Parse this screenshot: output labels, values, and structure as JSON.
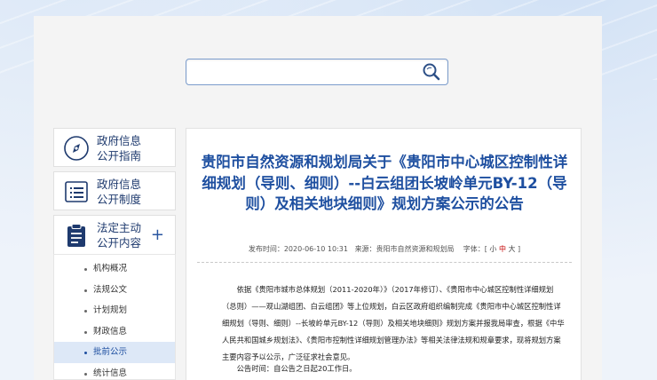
{
  "search": {
    "value": "",
    "placeholder": ""
  },
  "sidebar": {
    "items": [
      {
        "line1": "政府信息",
        "line2": "公开指南",
        "icon": "compass-icon"
      },
      {
        "line1": "政府信息",
        "line2": "公开制度",
        "icon": "list-icon"
      },
      {
        "line1": "法定主动",
        "line2": "公开内容",
        "icon": "clipboard-icon",
        "plus": "+"
      }
    ],
    "sub_items": [
      {
        "label": "机构概况",
        "active": false
      },
      {
        "label": "法规公文",
        "active": false
      },
      {
        "label": "计划规划",
        "active": false
      },
      {
        "label": "财政信息",
        "active": false
      },
      {
        "label": "批前公示",
        "active": true
      },
      {
        "label": "统计信息",
        "active": false
      }
    ]
  },
  "article": {
    "title": "贵阳市自然资源和规划局关于《贵阳市中心城区控制性详细规划（导则、细则）--白云组团长坡岭单元BY-12（导则）及相关地块细则》规划方案公示的公告",
    "meta": {
      "time_label": "发布时间：",
      "time": "2020-06-10 10:31",
      "source_label": "来源：",
      "source": "贵阳市自然资源和规划局",
      "font_label": "字体：[",
      "font_small": "小",
      "font_mid": "中",
      "font_large": "大",
      "font_close": "]"
    },
    "paragraph": "依据《贵阳市城市总体规划（2011-2020年）》（2017年修订）、《贵阳市中心城区控制性详细规划（总则）——观山湖组团、白云组团》等上位规划，白云区政府组织编制完成《贵阳市中心城区控制性详细规划（导则、细则）--长坡岭单元BY-12（导则）及相关地块细则》规划方案并报我局审查，根据《中华人民共和国城乡规划法》、《贵阳市控制性详细规划管理办法》等相关法律法规和规章要求，现将规划方案主要内容予以公示，广泛征求社会意见。",
    "notice": "公告时间：自公告之日起20工作日。"
  },
  "colors": {
    "accent": "#1e4fa0",
    "nav_text": "#1e3a6e",
    "active_bg": "#dde8f7",
    "font_mid": "#c40000"
  }
}
